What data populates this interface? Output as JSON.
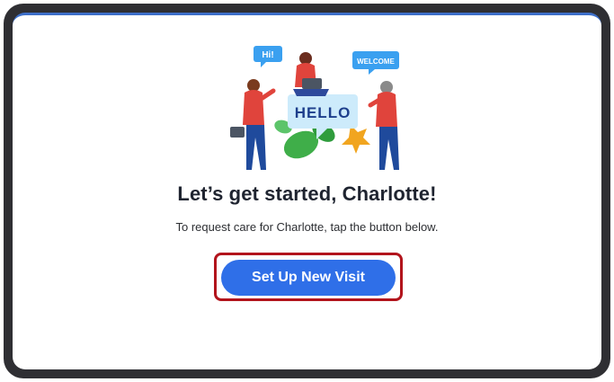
{
  "illustration": {
    "bubbles": {
      "hi": "Hi!",
      "welcome": "WELCOME",
      "hello": "HELLO"
    }
  },
  "main": {
    "headline": "Let’s get started, Charlotte!",
    "subtext": "To request care for Charlotte, tap the button below.",
    "primary_button_label": "Set Up New Visit"
  },
  "colors": {
    "primary": "#2f6fe8",
    "highlight_border": "#b2141c",
    "frame": "#2f2f33",
    "top_accent": "#3d6fc9"
  },
  "icons": {
    "illustration": "people-greeting-illustration"
  }
}
